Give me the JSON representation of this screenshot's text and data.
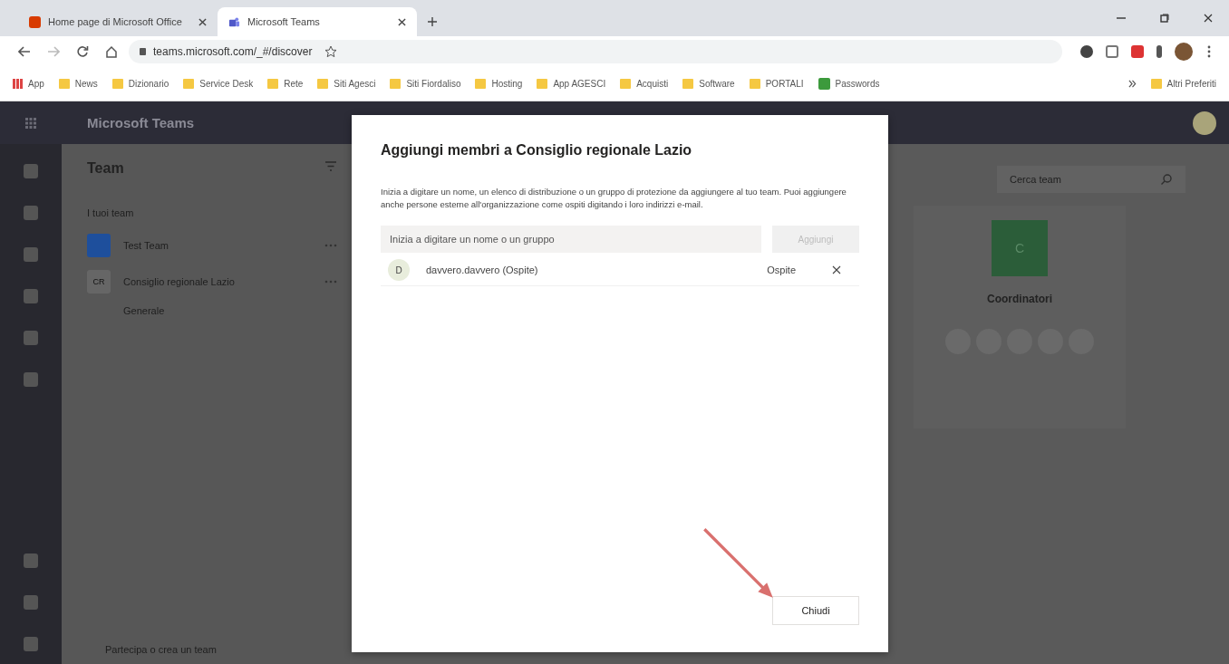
{
  "browser": {
    "tabs": [
      {
        "title": "Home page di Microsoft Office",
        "selected": false
      },
      {
        "title": "Microsoft Teams",
        "selected": true
      }
    ],
    "url": "teams.microsoft.com/_#/discover",
    "bookmarks": [
      {
        "label": "App",
        "kind": "apps"
      },
      {
        "label": "News",
        "kind": "folder"
      },
      {
        "label": "Dizionario",
        "kind": "folder"
      },
      {
        "label": "Service Desk",
        "kind": "folder"
      },
      {
        "label": "Rete",
        "kind": "folder"
      },
      {
        "label": "Siti Agesci",
        "kind": "folder"
      },
      {
        "label": "Siti Fiordaliso",
        "kind": "folder"
      },
      {
        "label": "Hosting",
        "kind": "folder"
      },
      {
        "label": "App AGESCI",
        "kind": "folder"
      },
      {
        "label": "Acquisti",
        "kind": "folder"
      },
      {
        "label": "Software",
        "kind": "folder"
      },
      {
        "label": "PORTALI",
        "kind": "folder"
      },
      {
        "label": "Passwords",
        "kind": "app"
      }
    ],
    "other_bookmarks": "Altri Preferiti"
  },
  "teams": {
    "app_title": "Microsoft Teams",
    "panel_title": "Team",
    "section_label": "I tuoi team",
    "team_list": [
      {
        "name": "Test Team",
        "color": "#1e4f9c"
      },
      {
        "name": "Consiglio regionale Lazio",
        "initials": "CR",
        "color": "#666666"
      }
    ],
    "channel": "Generale",
    "join_label": "Partecipa o crea un team",
    "search_placeholder": "Cerca team",
    "card": {
      "initial": "C",
      "name": "Coordinatori"
    }
  },
  "dialog": {
    "title": "Aggiungi membri a Consiglio regionale Lazio",
    "description": "Inizia a digitare un nome, un elenco di distribuzione o un gruppo di protezione da aggiungere al tuo team. Puoi aggiungere anche persone esterne all'organizzazione come ospiti digitando i loro indirizzi e-mail.",
    "input_placeholder": "Inizia a digitare un nome o un gruppo",
    "add_button": {
      "label": "Aggiungi",
      "disabled": true
    },
    "members": [
      {
        "initial": "D",
        "name": "davvero.davvero (Ospite)",
        "role": "Ospite"
      }
    ],
    "close_button": "Chiudi"
  }
}
